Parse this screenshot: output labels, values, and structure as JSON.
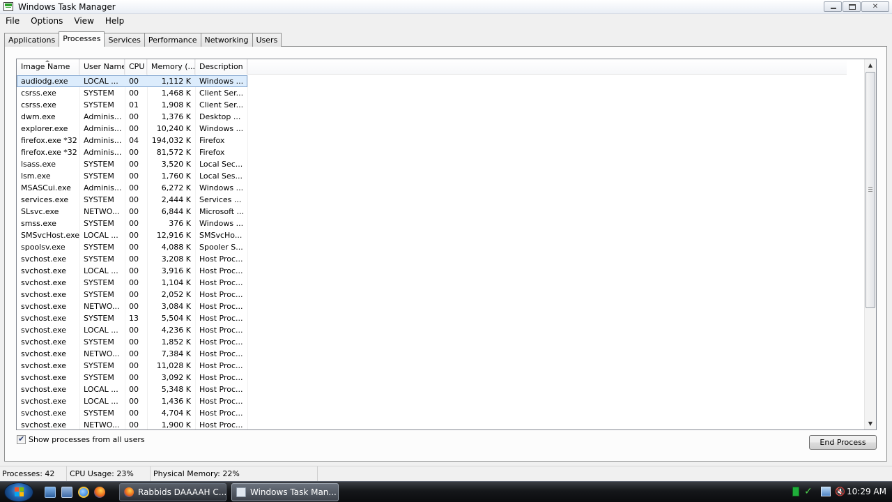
{
  "window": {
    "title": "Windows Task Manager",
    "buttons": {
      "minimize": "minimize",
      "maximize": "restore",
      "close": "close"
    }
  },
  "menu": [
    "File",
    "Options",
    "View",
    "Help"
  ],
  "tabs": [
    "Applications",
    "Processes",
    "Services",
    "Performance",
    "Networking",
    "Users"
  ],
  "active_tab": "Processes",
  "columns": [
    "Image Name",
    "User Name",
    "CPU",
    "Memory (...",
    "Description"
  ],
  "processes": [
    {
      "name": "audiodg.exe",
      "user": "LOCAL ...",
      "cpu": "00",
      "mem": "1,112 K",
      "desc": "Windows ..."
    },
    {
      "name": "csrss.exe",
      "user": "SYSTEM",
      "cpu": "00",
      "mem": "1,468 K",
      "desc": "Client Ser..."
    },
    {
      "name": "csrss.exe",
      "user": "SYSTEM",
      "cpu": "01",
      "mem": "1,908 K",
      "desc": "Client Ser..."
    },
    {
      "name": "dwm.exe",
      "user": "Adminis...",
      "cpu": "00",
      "mem": "1,376 K",
      "desc": "Desktop ..."
    },
    {
      "name": "explorer.exe",
      "user": "Adminis...",
      "cpu": "00",
      "mem": "10,240 K",
      "desc": "Windows ..."
    },
    {
      "name": "firefox.exe *32",
      "user": "Adminis...",
      "cpu": "04",
      "mem": "194,032 K",
      "desc": "Firefox"
    },
    {
      "name": "firefox.exe *32",
      "user": "Adminis...",
      "cpu": "00",
      "mem": "81,572 K",
      "desc": "Firefox"
    },
    {
      "name": "lsass.exe",
      "user": "SYSTEM",
      "cpu": "00",
      "mem": "3,520 K",
      "desc": "Local Sec..."
    },
    {
      "name": "lsm.exe",
      "user": "SYSTEM",
      "cpu": "00",
      "mem": "1,760 K",
      "desc": "Local Ses..."
    },
    {
      "name": "MSASCui.exe",
      "user": "Adminis...",
      "cpu": "00",
      "mem": "6,272 K",
      "desc": "Windows ..."
    },
    {
      "name": "services.exe",
      "user": "SYSTEM",
      "cpu": "00",
      "mem": "2,444 K",
      "desc": "Services ..."
    },
    {
      "name": "SLsvc.exe",
      "user": "NETWO...",
      "cpu": "00",
      "mem": "6,844 K",
      "desc": "Microsoft ..."
    },
    {
      "name": "smss.exe",
      "user": "SYSTEM",
      "cpu": "00",
      "mem": "376 K",
      "desc": "Windows ..."
    },
    {
      "name": "SMSvcHost.exe",
      "user": "LOCAL ...",
      "cpu": "00",
      "mem": "12,916 K",
      "desc": "SMSvcHo..."
    },
    {
      "name": "spoolsv.exe",
      "user": "SYSTEM",
      "cpu": "00",
      "mem": "4,088 K",
      "desc": "Spooler S..."
    },
    {
      "name": "svchost.exe",
      "user": "SYSTEM",
      "cpu": "00",
      "mem": "3,208 K",
      "desc": "Host Proc..."
    },
    {
      "name": "svchost.exe",
      "user": "LOCAL ...",
      "cpu": "00",
      "mem": "3,916 K",
      "desc": "Host Proc..."
    },
    {
      "name": "svchost.exe",
      "user": "SYSTEM",
      "cpu": "00",
      "mem": "1,104 K",
      "desc": "Host Proc..."
    },
    {
      "name": "svchost.exe",
      "user": "SYSTEM",
      "cpu": "00",
      "mem": "2,052 K",
      "desc": "Host Proc..."
    },
    {
      "name": "svchost.exe",
      "user": "NETWO...",
      "cpu": "00",
      "mem": "3,084 K",
      "desc": "Host Proc..."
    },
    {
      "name": "svchost.exe",
      "user": "SYSTEM",
      "cpu": "13",
      "mem": "5,504 K",
      "desc": "Host Proc..."
    },
    {
      "name": "svchost.exe",
      "user": "LOCAL ...",
      "cpu": "00",
      "mem": "4,236 K",
      "desc": "Host Proc..."
    },
    {
      "name": "svchost.exe",
      "user": "SYSTEM",
      "cpu": "00",
      "mem": "1,852 K",
      "desc": "Host Proc..."
    },
    {
      "name": "svchost.exe",
      "user": "NETWO...",
      "cpu": "00",
      "mem": "7,384 K",
      "desc": "Host Proc..."
    },
    {
      "name": "svchost.exe",
      "user": "SYSTEM",
      "cpu": "00",
      "mem": "11,028 K",
      "desc": "Host Proc..."
    },
    {
      "name": "svchost.exe",
      "user": "SYSTEM",
      "cpu": "00",
      "mem": "3,092 K",
      "desc": "Host Proc..."
    },
    {
      "name": "svchost.exe",
      "user": "LOCAL ...",
      "cpu": "00",
      "mem": "5,348 K",
      "desc": "Host Proc..."
    },
    {
      "name": "svchost.exe",
      "user": "LOCAL ...",
      "cpu": "00",
      "mem": "1,436 K",
      "desc": "Host Proc..."
    },
    {
      "name": "svchost.exe",
      "user": "SYSTEM",
      "cpu": "00",
      "mem": "4,704 K",
      "desc": "Host Proc..."
    },
    {
      "name": "svchost.exe",
      "user": "NETWO...",
      "cpu": "00",
      "mem": "1,900 K",
      "desc": "Host Proc..."
    }
  ],
  "selected_row": 0,
  "show_all_users": {
    "label": "Show processes from all users",
    "checked": true
  },
  "end_process_label": "End Process",
  "status": {
    "processes": "Processes: 42",
    "cpu": "CPU Usage: 23%",
    "memory": "Physical Memory: 22%"
  },
  "taskbar": {
    "items": [
      {
        "label": "Rabbids DAAAAH C...",
        "icon": "firefox-icon",
        "active": false
      },
      {
        "label": "Windows Task Man...",
        "icon": "task-manager-icon",
        "active": true
      }
    ],
    "clock": "10:29 AM"
  },
  "colors": {
    "selection": "#dcecfc",
    "selection_border": "#7da2ce",
    "taskbar": "#15171a",
    "window_bg": "#f0f0f0"
  }
}
